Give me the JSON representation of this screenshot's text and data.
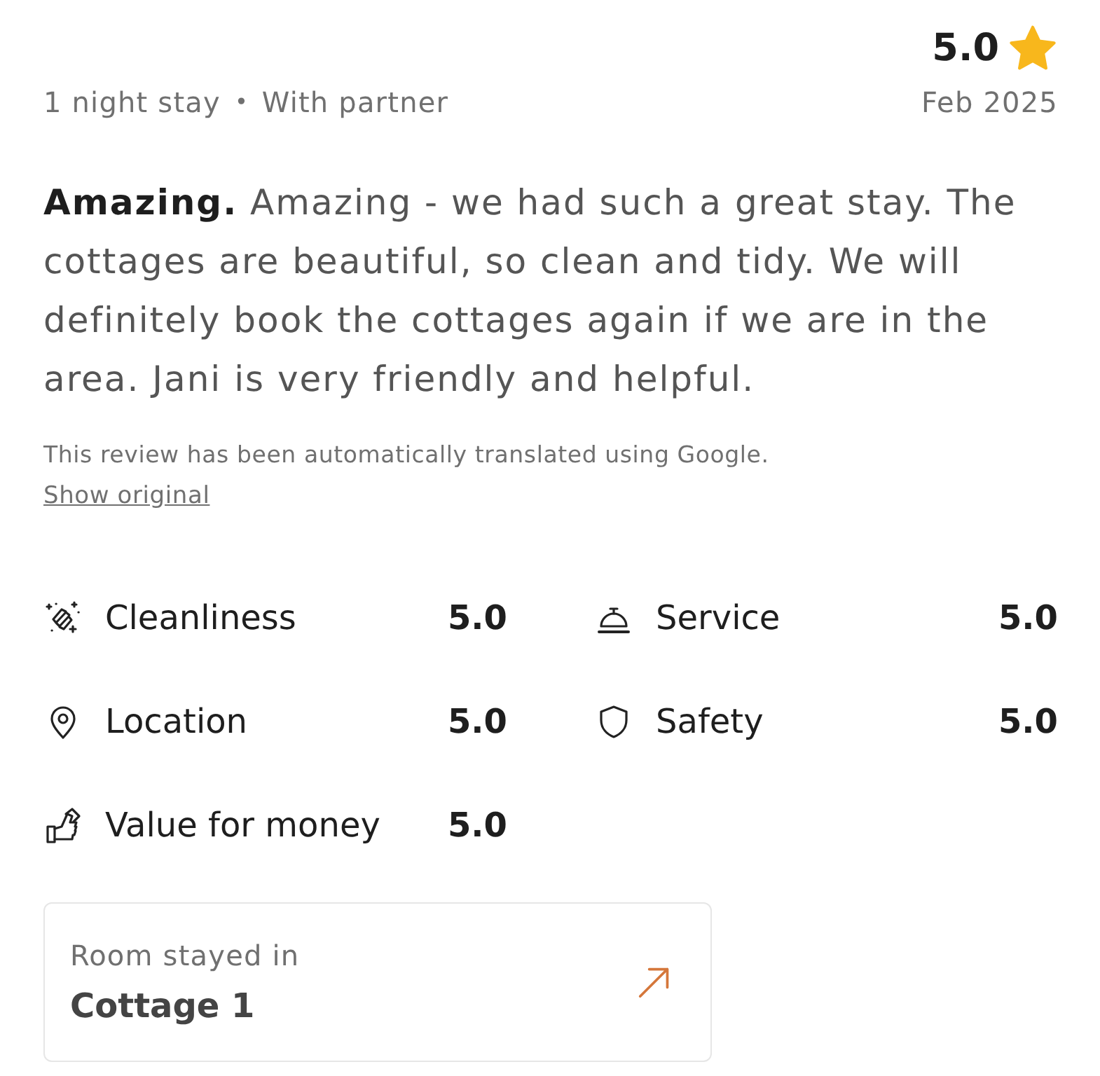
{
  "overall": {
    "score": "5.0"
  },
  "stay": {
    "details": [
      "1 night stay",
      "With partner"
    ],
    "separator": "•",
    "date": "Feb 2025"
  },
  "review": {
    "text": "**Amazing.** Amazing - we had such a great stay. The cottages are beautiful, so clean and tidy. We will definitely book the cottages again if we are in the area. Jani is very friendly and helpful."
  },
  "translation": {
    "note": "This review has been automatically translated using Google.",
    "link": "Show original"
  },
  "ratings": [
    {
      "kind": "cleanliness",
      "label": "Cleanliness",
      "score": "5.0"
    },
    {
      "kind": "service",
      "label": "Service",
      "score": "5.0"
    },
    {
      "kind": "location",
      "label": "Location",
      "score": "5.0"
    },
    {
      "kind": "safety",
      "label": "Safety",
      "score": "5.0"
    },
    {
      "kind": "value",
      "label": "Value for money",
      "score": "5.0"
    }
  ],
  "room": {
    "label": "Room stayed in",
    "name": "Cottage 1"
  }
}
